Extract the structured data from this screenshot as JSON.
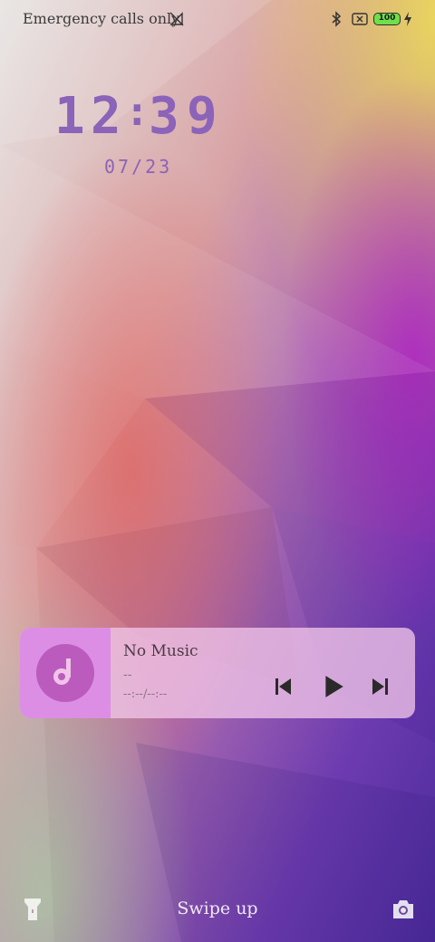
{
  "status_bar": {
    "carrier_text": "Emergency calls only",
    "battery_level": "100",
    "icons": [
      "no-signal-icon",
      "bluetooth-icon",
      "sim-x-icon",
      "battery-icon",
      "charging-bolt-icon"
    ]
  },
  "lock_clock": {
    "digits": [
      "1",
      "2",
      ":",
      "3",
      "9"
    ],
    "date": "07/23"
  },
  "music_player": {
    "title": "No Music",
    "artist": "--",
    "time": "--:--/--:--",
    "controls": [
      "previous-icon",
      "play-icon",
      "next-icon"
    ]
  },
  "bottom": {
    "hint": "Swipe up",
    "left_icon": "flashlight-icon",
    "right_icon": "camera-icon"
  },
  "colors": {
    "clock": "#8b63b8",
    "battery_fill": "#6ee04a",
    "album_art": "#dc8ee4"
  }
}
